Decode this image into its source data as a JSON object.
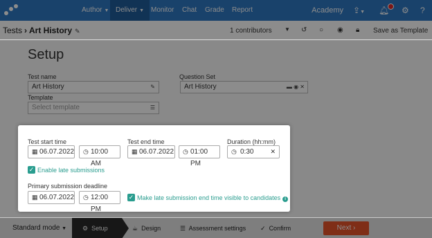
{
  "topnav": {
    "items": [
      {
        "label": "Author",
        "has_caret": true
      },
      {
        "label": "Deliver",
        "has_caret": true
      },
      {
        "label": "Monitor"
      },
      {
        "label": "Chat"
      },
      {
        "label": "Grade"
      },
      {
        "label": "Report"
      }
    ],
    "academy": "Academy",
    "icons": [
      "logo-icon",
      "upload-icon",
      "bell-icon",
      "gear-icon",
      "help-icon"
    ],
    "bg_color": "#2f79c4",
    "active_item": "Deliver"
  },
  "subbar": {
    "breadcrumb_root": "Tests",
    "test_title": "Art History",
    "contributors": "1 contributors",
    "save_as_template": "Save as Template"
  },
  "main": {
    "title": "Setup",
    "test_name_label": "Test name",
    "test_name_value": "Art History",
    "question_set_label": "Question Set",
    "question_set_value": "Art History",
    "template_label": "Template",
    "template_placeholder": "Select template"
  },
  "dialog": {
    "start_label": "Test start time",
    "start_date": "06.07.2022",
    "start_time": "10:00 AM",
    "end_label": "Test end time",
    "end_date": "06.07.2022",
    "end_time": "01:00 PM",
    "duration_label": "Duration (hh:mm)",
    "duration_value": "0:30",
    "late_submissions_label": "Enable late submissions",
    "deadline_label": "Primary submission deadline",
    "deadline_date": "06.07.2022",
    "deadline_time": "12:00 PM",
    "make_visible_label": "Make late submission end time visible to candidates",
    "accent_color": "#2a9d8f"
  },
  "bottombar": {
    "mode": "Standard mode",
    "steps": [
      "Setup",
      "Design",
      "Assessment settings",
      "Confirm"
    ],
    "active_step": "Setup",
    "next": "Next",
    "next_color": "#e8542a"
  }
}
